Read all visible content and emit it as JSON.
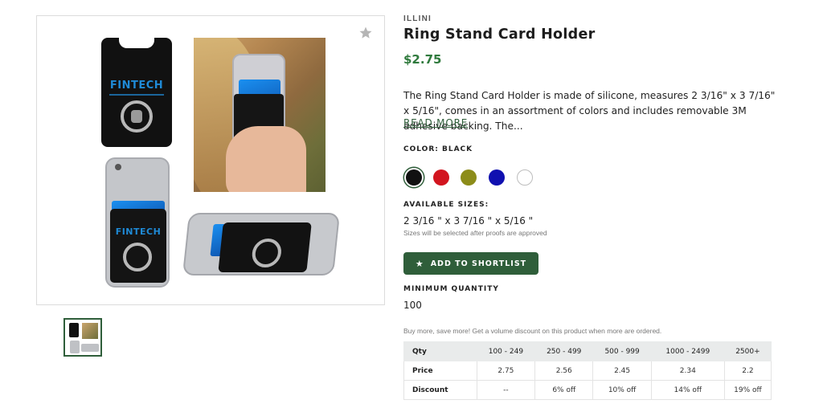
{
  "product": {
    "brand": "ILLINI",
    "title": "Ring Stand Card Holder",
    "price": "$2.75",
    "description": "The Ring Stand Card Holder is made of silicone, measures 2 3/16\" x 3 7/16\" x 5/16\", comes in an assortment of colors and includes removable 3M adhesive backing. The...",
    "read_more_label": "READ MORE",
    "image_brand_text": "FINTECH"
  },
  "color": {
    "label": "COLOR:",
    "selected": "BLACK",
    "swatches": [
      {
        "name": "black",
        "hex": "#111111"
      },
      {
        "name": "red",
        "hex": "#d2151f"
      },
      {
        "name": "olive",
        "hex": "#8c8c1a"
      },
      {
        "name": "blue",
        "hex": "#1010b0"
      },
      {
        "name": "white",
        "hex": "#ffffff"
      }
    ]
  },
  "sizes": {
    "label": "AVAILABLE SIZES:",
    "value": "2 3/16 \" x 3 7/16 \" x 5/16 \"",
    "note": "Sizes will be selected after proofs are approved"
  },
  "shortlist": {
    "label": "ADD TO SHORTLIST",
    "icon": "star-icon"
  },
  "minimum_quantity": {
    "label": "MINIMUM QUANTITY",
    "value": "100"
  },
  "volume_note": "Buy more, save more! Get a volume discount on this product when more are ordered.",
  "pricing_table": {
    "header": [
      "Qty",
      "100 - 249",
      "250 - 499",
      "500 - 999",
      "1000 - 2499",
      "2500+"
    ],
    "rows": [
      {
        "label": "Price",
        "cells": [
          "2.75",
          "2.56",
          "2.45",
          "2.34",
          "2.2"
        ]
      },
      {
        "label": "Discount",
        "cells": [
          "--",
          "6% off",
          "10% off",
          "14% off",
          "19% off"
        ]
      }
    ]
  },
  "colors": {
    "accent": "#2f5e3a",
    "price": "#2f7a3d"
  }
}
